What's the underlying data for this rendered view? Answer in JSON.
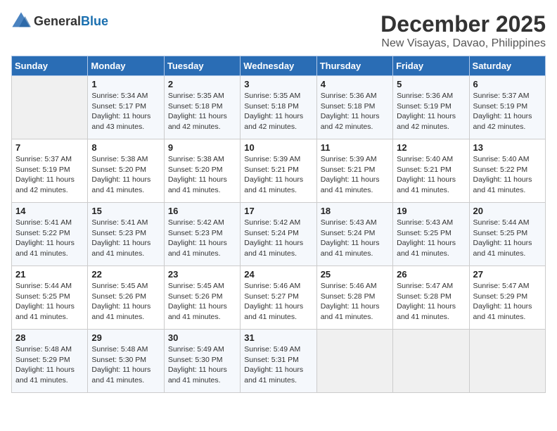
{
  "header": {
    "logo_general": "General",
    "logo_blue": "Blue",
    "month": "December 2025",
    "location": "New Visayas, Davao, Philippines"
  },
  "days_of_week": [
    "Sunday",
    "Monday",
    "Tuesday",
    "Wednesday",
    "Thursday",
    "Friday",
    "Saturday"
  ],
  "weeks": [
    [
      {
        "day": "",
        "sunrise": "",
        "sunset": "",
        "daylight": ""
      },
      {
        "day": "1",
        "sunrise": "Sunrise: 5:34 AM",
        "sunset": "Sunset: 5:17 PM",
        "daylight": "Daylight: 11 hours and 43 minutes."
      },
      {
        "day": "2",
        "sunrise": "Sunrise: 5:35 AM",
        "sunset": "Sunset: 5:18 PM",
        "daylight": "Daylight: 11 hours and 42 minutes."
      },
      {
        "day": "3",
        "sunrise": "Sunrise: 5:35 AM",
        "sunset": "Sunset: 5:18 PM",
        "daylight": "Daylight: 11 hours and 42 minutes."
      },
      {
        "day": "4",
        "sunrise": "Sunrise: 5:36 AM",
        "sunset": "Sunset: 5:18 PM",
        "daylight": "Daylight: 11 hours and 42 minutes."
      },
      {
        "day": "5",
        "sunrise": "Sunrise: 5:36 AM",
        "sunset": "Sunset: 5:19 PM",
        "daylight": "Daylight: 11 hours and 42 minutes."
      },
      {
        "day": "6",
        "sunrise": "Sunrise: 5:37 AM",
        "sunset": "Sunset: 5:19 PM",
        "daylight": "Daylight: 11 hours and 42 minutes."
      }
    ],
    [
      {
        "day": "7",
        "sunrise": "Sunrise: 5:37 AM",
        "sunset": "Sunset: 5:19 PM",
        "daylight": "Daylight: 11 hours and 42 minutes."
      },
      {
        "day": "8",
        "sunrise": "Sunrise: 5:38 AM",
        "sunset": "Sunset: 5:20 PM",
        "daylight": "Daylight: 11 hours and 41 minutes."
      },
      {
        "day": "9",
        "sunrise": "Sunrise: 5:38 AM",
        "sunset": "Sunset: 5:20 PM",
        "daylight": "Daylight: 11 hours and 41 minutes."
      },
      {
        "day": "10",
        "sunrise": "Sunrise: 5:39 AM",
        "sunset": "Sunset: 5:21 PM",
        "daylight": "Daylight: 11 hours and 41 minutes."
      },
      {
        "day": "11",
        "sunrise": "Sunrise: 5:39 AM",
        "sunset": "Sunset: 5:21 PM",
        "daylight": "Daylight: 11 hours and 41 minutes."
      },
      {
        "day": "12",
        "sunrise": "Sunrise: 5:40 AM",
        "sunset": "Sunset: 5:21 PM",
        "daylight": "Daylight: 11 hours and 41 minutes."
      },
      {
        "day": "13",
        "sunrise": "Sunrise: 5:40 AM",
        "sunset": "Sunset: 5:22 PM",
        "daylight": "Daylight: 11 hours and 41 minutes."
      }
    ],
    [
      {
        "day": "14",
        "sunrise": "Sunrise: 5:41 AM",
        "sunset": "Sunset: 5:22 PM",
        "daylight": "Daylight: 11 hours and 41 minutes."
      },
      {
        "day": "15",
        "sunrise": "Sunrise: 5:41 AM",
        "sunset": "Sunset: 5:23 PM",
        "daylight": "Daylight: 11 hours and 41 minutes."
      },
      {
        "day": "16",
        "sunrise": "Sunrise: 5:42 AM",
        "sunset": "Sunset: 5:23 PM",
        "daylight": "Daylight: 11 hours and 41 minutes."
      },
      {
        "day": "17",
        "sunrise": "Sunrise: 5:42 AM",
        "sunset": "Sunset: 5:24 PM",
        "daylight": "Daylight: 11 hours and 41 minutes."
      },
      {
        "day": "18",
        "sunrise": "Sunrise: 5:43 AM",
        "sunset": "Sunset: 5:24 PM",
        "daylight": "Daylight: 11 hours and 41 minutes."
      },
      {
        "day": "19",
        "sunrise": "Sunrise: 5:43 AM",
        "sunset": "Sunset: 5:25 PM",
        "daylight": "Daylight: 11 hours and 41 minutes."
      },
      {
        "day": "20",
        "sunrise": "Sunrise: 5:44 AM",
        "sunset": "Sunset: 5:25 PM",
        "daylight": "Daylight: 11 hours and 41 minutes."
      }
    ],
    [
      {
        "day": "21",
        "sunrise": "Sunrise: 5:44 AM",
        "sunset": "Sunset: 5:25 PM",
        "daylight": "Daylight: 11 hours and 41 minutes."
      },
      {
        "day": "22",
        "sunrise": "Sunrise: 5:45 AM",
        "sunset": "Sunset: 5:26 PM",
        "daylight": "Daylight: 11 hours and 41 minutes."
      },
      {
        "day": "23",
        "sunrise": "Sunrise: 5:45 AM",
        "sunset": "Sunset: 5:26 PM",
        "daylight": "Daylight: 11 hours and 41 minutes."
      },
      {
        "day": "24",
        "sunrise": "Sunrise: 5:46 AM",
        "sunset": "Sunset: 5:27 PM",
        "daylight": "Daylight: 11 hours and 41 minutes."
      },
      {
        "day": "25",
        "sunrise": "Sunrise: 5:46 AM",
        "sunset": "Sunset: 5:28 PM",
        "daylight": "Daylight: 11 hours and 41 minutes."
      },
      {
        "day": "26",
        "sunrise": "Sunrise: 5:47 AM",
        "sunset": "Sunset: 5:28 PM",
        "daylight": "Daylight: 11 hours and 41 minutes."
      },
      {
        "day": "27",
        "sunrise": "Sunrise: 5:47 AM",
        "sunset": "Sunset: 5:29 PM",
        "daylight": "Daylight: 11 hours and 41 minutes."
      }
    ],
    [
      {
        "day": "28",
        "sunrise": "Sunrise: 5:48 AM",
        "sunset": "Sunset: 5:29 PM",
        "daylight": "Daylight: 11 hours and 41 minutes."
      },
      {
        "day": "29",
        "sunrise": "Sunrise: 5:48 AM",
        "sunset": "Sunset: 5:30 PM",
        "daylight": "Daylight: 11 hours and 41 minutes."
      },
      {
        "day": "30",
        "sunrise": "Sunrise: 5:49 AM",
        "sunset": "Sunset: 5:30 PM",
        "daylight": "Daylight: 11 hours and 41 minutes."
      },
      {
        "day": "31",
        "sunrise": "Sunrise: 5:49 AM",
        "sunset": "Sunset: 5:31 PM",
        "daylight": "Daylight: 11 hours and 41 minutes."
      },
      {
        "day": "",
        "sunrise": "",
        "sunset": "",
        "daylight": ""
      },
      {
        "day": "",
        "sunrise": "",
        "sunset": "",
        "daylight": ""
      },
      {
        "day": "",
        "sunrise": "",
        "sunset": "",
        "daylight": ""
      }
    ]
  ]
}
